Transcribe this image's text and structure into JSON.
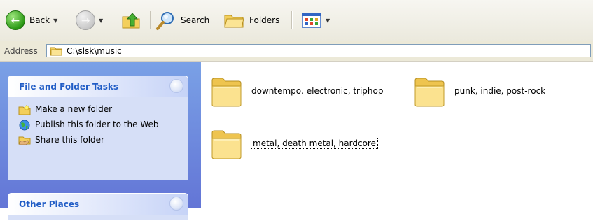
{
  "toolbar": {
    "back_label": "Back",
    "search_label": "Search",
    "folders_label": "Folders"
  },
  "address": {
    "label_prefix": "A",
    "label_ul": "d",
    "label_suffix": "dress",
    "path": "C:\\slsk\\music"
  },
  "left_pane": {
    "file_folder_tasks": {
      "title": "File and Folder Tasks",
      "items": [
        {
          "label": "Make a new folder",
          "icon": "new-folder-icon"
        },
        {
          "label": "Publish this folder to the Web",
          "icon": "globe-icon"
        },
        {
          "label": "Share this folder",
          "icon": "share-folder-icon"
        }
      ]
    },
    "other_places": {
      "title": "Other Places"
    }
  },
  "folders": [
    {
      "name": "downtempo, electronic, triphop",
      "selected": false
    },
    {
      "name": "punk, indie, post-rock",
      "selected": false
    },
    {
      "name": "metal, death metal, hardcore",
      "selected": true
    }
  ],
  "colors": {
    "taskpane_bg": "#6375d6",
    "panel_bg": "#d6dff7",
    "panel_title": "#215dc6",
    "folder_yellow": "#f5d96b"
  }
}
